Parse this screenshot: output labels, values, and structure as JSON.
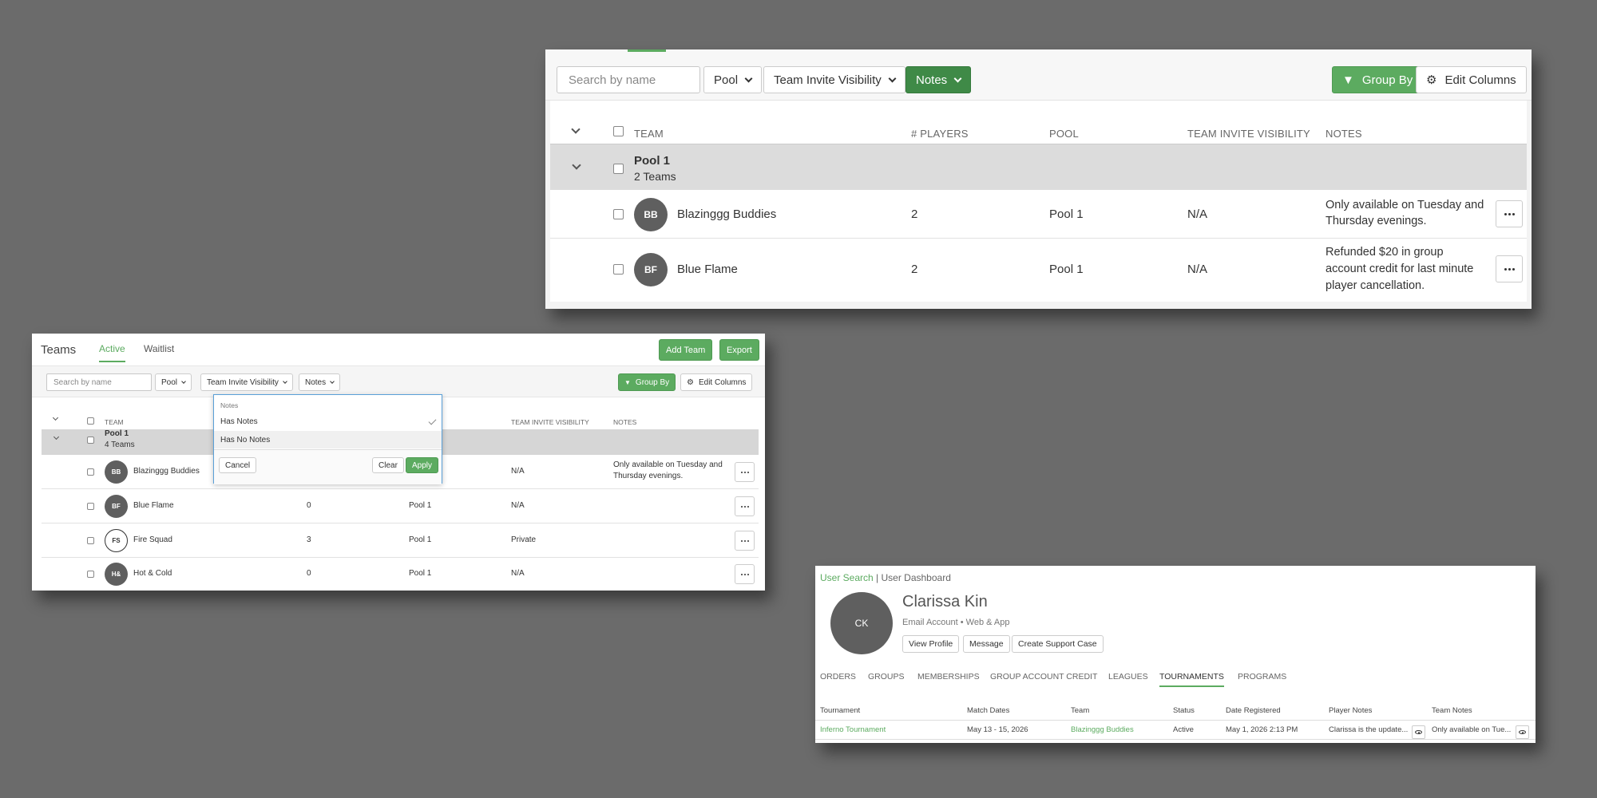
{
  "card1": {
    "toolbar": {
      "search_placeholder": "Search by name",
      "pool_label": "Pool",
      "visibility_label": "Team Invite Visibility",
      "notes_label": "Notes",
      "group_by_label": "Group By",
      "edit_columns_label": "Edit Columns"
    },
    "columns": [
      "TEAM",
      "# PLAYERS",
      "POOL",
      "TEAM INVITE VISIBILITY",
      "NOTES"
    ],
    "group": {
      "name": "Pool 1",
      "count": "2 Teams"
    },
    "rows": [
      {
        "initials": "BB",
        "team": "Blazinggg Buddies",
        "players": "2",
        "pool": "Pool 1",
        "visibility": "N/A",
        "notes": "Only available on Tuesday and Thursday evenings."
      },
      {
        "initials": "BF",
        "team": "Blue Flame",
        "players": "2",
        "pool": "Pool 1",
        "visibility": "N/A",
        "notes": "Refunded $20 in group account credit for last minute player cancellation."
      }
    ]
  },
  "card2": {
    "title": "Teams",
    "tabs": [
      "Active",
      "Waitlist"
    ],
    "add_team_label": "Add Team",
    "export_label": "Export",
    "toolbar": {
      "search_placeholder": "Search by name",
      "pool_label": "Pool",
      "visibility_label": "Team Invite Visibility",
      "notes_label": "Notes",
      "group_by_label": "Group By",
      "edit_columns_label": "Edit Columns"
    },
    "columns": [
      "TEAM",
      "TEAM INVITE VISIBILITY",
      "NOTES"
    ],
    "group": {
      "name": "Pool 1",
      "count": "4 Teams"
    },
    "rows": [
      {
        "initials": "BB",
        "team": "Blazinggg Buddies",
        "players": "",
        "pool": "",
        "visibility": "N/A",
        "notes": "Only available on Tuesday and Thursday evenings.",
        "avatar_style": "filled"
      },
      {
        "initials": "BF",
        "team": "Blue Flame",
        "players": "0",
        "pool": "Pool 1",
        "visibility": "N/A",
        "notes": "",
        "avatar_style": "filled"
      },
      {
        "initials": "FS",
        "team": "Fire Squad",
        "players": "3",
        "pool": "Pool 1",
        "visibility": "Private",
        "notes": "",
        "avatar_style": "outline"
      },
      {
        "initials": "H&",
        "team": "Hot & Cold",
        "players": "0",
        "pool": "Pool 1",
        "visibility": "N/A",
        "notes": "",
        "avatar_style": "filled"
      }
    ],
    "dropdown": {
      "title": "Notes",
      "options": [
        {
          "label": "Has Notes",
          "selected": true
        },
        {
          "label": "Has No Notes",
          "selected": false
        }
      ],
      "cancel_label": "Cancel",
      "clear_label": "Clear",
      "apply_label": "Apply"
    }
  },
  "card3": {
    "breadcrumb_link": "User Search",
    "breadcrumb_sep": " | ",
    "breadcrumb_current": "User Dashboard",
    "avatar_initials": "CK",
    "name": "Clarissa Kin",
    "subtitle": "Email Account • Web & App",
    "buttons": [
      "View Profile",
      "Message",
      "Create Support Case"
    ],
    "tabs": [
      "ORDERS",
      "GROUPS",
      "MEMBERSHIPS",
      "GROUP ACCOUNT CREDIT",
      "LEAGUES",
      "TOURNAMENTS",
      "PROGRAMS"
    ],
    "active_tab": "TOURNAMENTS",
    "columns": [
      "Tournament",
      "Match Dates",
      "Team",
      "Status",
      "Date Registered",
      "Player Notes",
      "Team Notes"
    ],
    "row": {
      "tournament": "Inferno Tournament",
      "match_dates": "May 13 - 15, 2026",
      "team": "Blazinggg Buddies",
      "status": "Active",
      "date_registered": "May 1, 2026 2:13 PM",
      "player_notes": "Clarissa is the update...",
      "team_notes": "Only available on Tue..."
    }
  },
  "colors": {
    "accent_green": "#5cab60",
    "notes_active_green": "#3f8a47",
    "background": "#6b6b6b"
  }
}
